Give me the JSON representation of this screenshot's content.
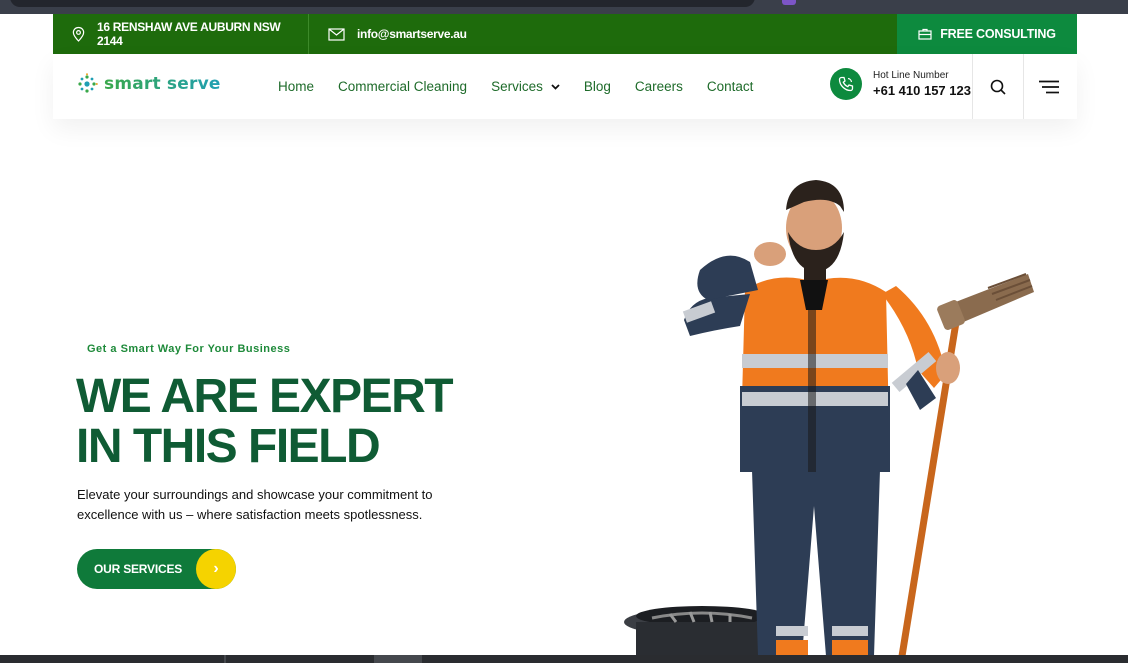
{
  "topbar": {
    "address": "16 RENSHAW AVE AUBURN NSW 2144",
    "email": "info@smartserve.au",
    "consult_label": "FREE CONSULTING"
  },
  "logo": {
    "text": "smart serve"
  },
  "nav": {
    "items": [
      "Home",
      "Commercial Cleaning",
      "Services",
      "Blog",
      "Careers",
      "Contact"
    ]
  },
  "hotline": {
    "label": "Hot Line Number",
    "number": "+61 410 157 123"
  },
  "hero": {
    "tagline": "Get a Smart Way For Your Business",
    "title_line1": "WE ARE EXPERT",
    "title_line2": "IN THIS FIELD",
    "text": "Elevate your surroundings and showcase your commitment to excellence with us – where satisfaction meets spotlessness.",
    "cta_label": "OUR SERVICES",
    "cta_arrow": "›"
  },
  "colors": {
    "topbar_bg": "#1e6b0c",
    "consult_bg": "#0d8a3e",
    "nav_text": "#1e6b2a",
    "title": "#0f5b34",
    "cta_arrow": "#f5d300"
  }
}
